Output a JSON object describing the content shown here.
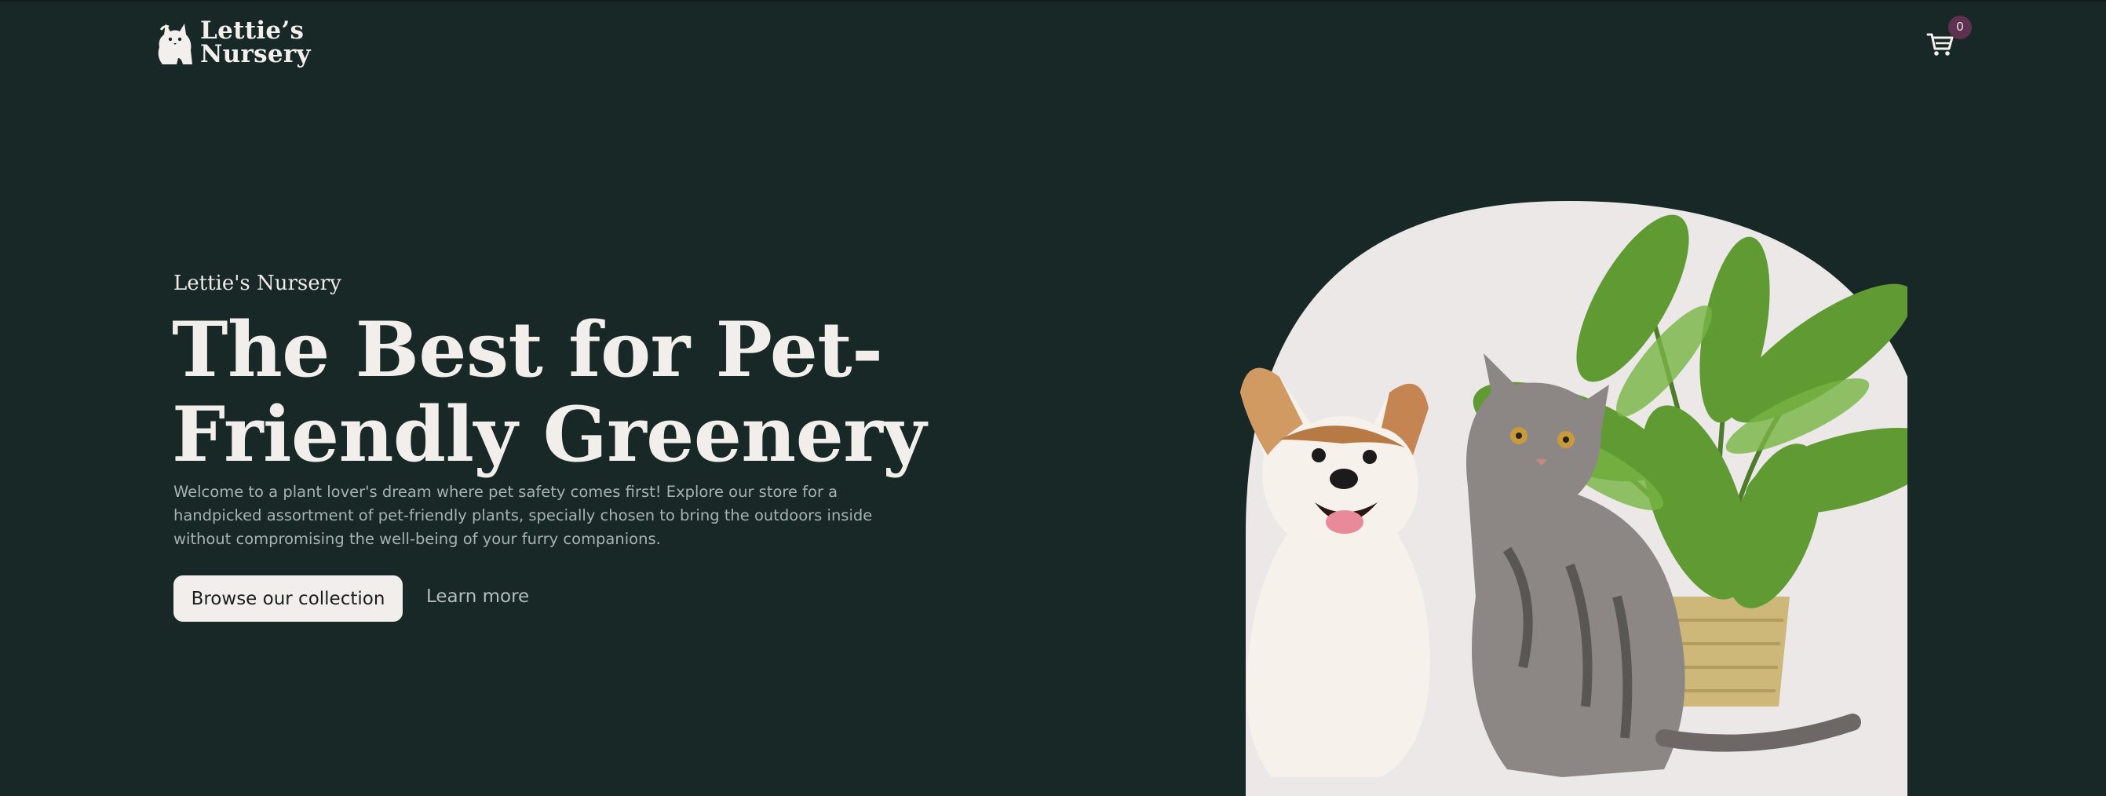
{
  "header": {
    "logo_line1": "Lettie’s",
    "logo_line2": "Nursery",
    "cart_count": "0"
  },
  "hero": {
    "eyebrow": "Lettie's Nursery",
    "headline": "The Best for Pet-Friendly Greenery",
    "intro": "Welcome to a plant lover's dream where pet safety comes first! Explore our store for a handpicked assortment of pet-friendly plants, specially chosen to bring the outdoors inside without compromising the well-being of your furry companions.",
    "primary_button": "Browse our collection",
    "secondary_link": "Learn more"
  },
  "colors": {
    "background": "#172826",
    "text_light": "#f2eeeb",
    "muted": "#a8b3b0",
    "badge": "#5e3150",
    "arch": "#ece8e7",
    "button_bg": "#f2eeec"
  },
  "icons": {
    "logo": "cat-logo-icon",
    "cart": "shopping-cart-icon"
  }
}
